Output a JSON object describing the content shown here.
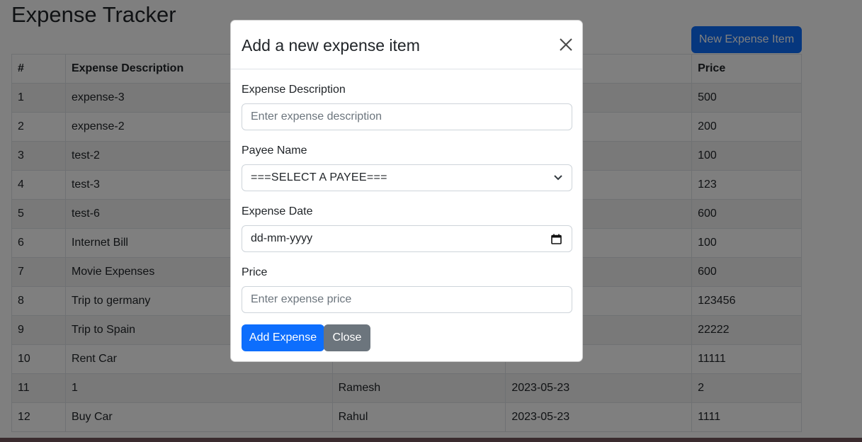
{
  "app": {
    "title": "Expense Tracker"
  },
  "toolbar": {
    "new_item_label": "New Expense Item"
  },
  "table": {
    "headers": {
      "id": "#",
      "description": "Expense Description",
      "payee": "",
      "date": "",
      "price": "Price"
    },
    "rows": [
      {
        "id": "1",
        "description": "expense-3",
        "payee": "",
        "date": "",
        "price": "500"
      },
      {
        "id": "2",
        "description": "expense-2",
        "payee": "",
        "date": "",
        "price": "200"
      },
      {
        "id": "3",
        "description": "test-2",
        "payee": "",
        "date": "",
        "price": "100"
      },
      {
        "id": "4",
        "description": "test-3",
        "payee": "",
        "date": "",
        "price": "123"
      },
      {
        "id": "5",
        "description": "test-6",
        "payee": "",
        "date": "",
        "price": "600"
      },
      {
        "id": "6",
        "description": "Internet Bill",
        "payee": "",
        "date": "",
        "price": "100"
      },
      {
        "id": "7",
        "description": "Movie Expenses",
        "payee": "",
        "date": "",
        "price": "600"
      },
      {
        "id": "8",
        "description": "Trip to germany",
        "payee": "",
        "date": "",
        "price": "123456"
      },
      {
        "id": "9",
        "description": "Trip to Spain",
        "payee": "",
        "date": "",
        "price": "22222"
      },
      {
        "id": "10",
        "description": "Rent Car",
        "payee": "",
        "date": "",
        "price": "11111"
      },
      {
        "id": "11",
        "description": "1",
        "payee": "Ramesh",
        "date": "2023-05-23",
        "price": "2"
      },
      {
        "id": "12",
        "description": "Buy Car",
        "payee": "Rahul",
        "date": "2023-05-23",
        "price": "1111"
      }
    ]
  },
  "modal": {
    "title": "Add a new expense item",
    "close_icon": "close-icon",
    "fields": {
      "description": {
        "label": "Expense Description",
        "placeholder": "Enter expense description",
        "value": ""
      },
      "payee": {
        "label": "Payee Name",
        "selected": "===SELECT A PAYEE==="
      },
      "date": {
        "label": "Expense Date",
        "value": "dd-mm-yyyy"
      },
      "price": {
        "label": "Price",
        "placeholder": "Enter expense price",
        "value": ""
      }
    },
    "buttons": {
      "add": "Add Expense",
      "close": "Close"
    }
  },
  "colors": {
    "primary": "#0d6efd",
    "secondary": "#6c757d",
    "backdrop": "#000000"
  }
}
